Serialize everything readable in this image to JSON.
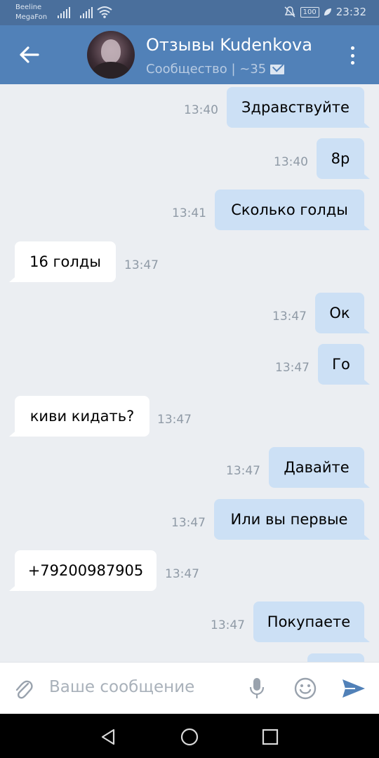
{
  "status": {
    "carrier1": "Beeline",
    "carrier2": "MegaFon",
    "battery": "100",
    "time": "23:32"
  },
  "header": {
    "title": "Отзывы Kudenkova",
    "subtitle": "Сообщество | ~35"
  },
  "messages": [
    {
      "text": "Здравствуйте",
      "time": "13:40",
      "dir": "out"
    },
    {
      "text": "8р",
      "time": "13:40",
      "dir": "out"
    },
    {
      "text": "Сколько голды",
      "time": "13:41",
      "dir": "out"
    },
    {
      "text": "16 голды",
      "time": "13:47",
      "dir": "in"
    },
    {
      "text": "Ок",
      "time": "13:47",
      "dir": "out"
    },
    {
      "text": "Го",
      "time": "13:47",
      "dir": "out"
    },
    {
      "text": "киви кидать?",
      "time": "13:47",
      "dir": "in"
    },
    {
      "text": "Давайте",
      "time": "13:47",
      "dir": "out"
    },
    {
      "text": "Или вы первые",
      "time": "13:47",
      "dir": "out"
    },
    {
      "text": "+79200987905",
      "time": "13:47",
      "dir": "in"
    },
    {
      "text": "Покупаете",
      "time": "13:47",
      "dir": "out"
    }
  ],
  "composer": {
    "placeholder": "Ваше сообщение"
  },
  "colors": {
    "header": "#5181b8",
    "statusbar": "#4a6f9c",
    "outgoing": "#cce0f5",
    "incoming": "#ffffff",
    "background": "#ebeef2",
    "accent": "#5181b8"
  },
  "icons": [
    "back-arrow-icon",
    "more-vert-icon",
    "envelope-icon",
    "attach-icon",
    "microphone-icon",
    "emoji-icon",
    "send-icon",
    "nav-back-icon",
    "nav-home-icon",
    "nav-recents-icon"
  ]
}
